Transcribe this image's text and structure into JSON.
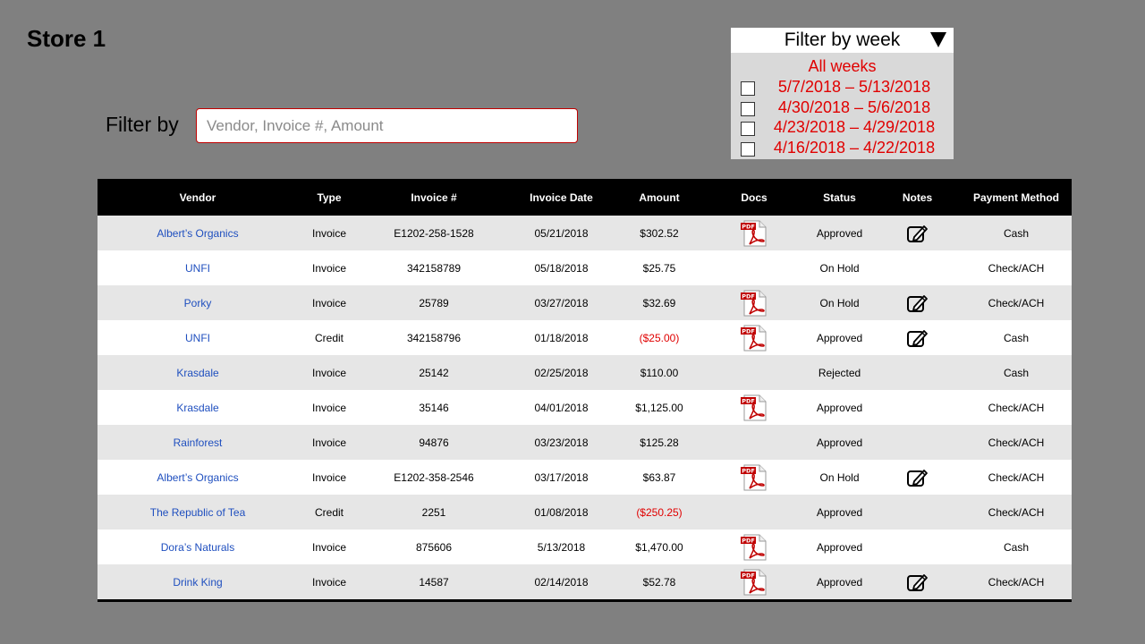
{
  "page": {
    "title": "Store 1"
  },
  "filter": {
    "label": "Filter by",
    "placeholder": "Vendor, Invoice #, Amount",
    "value": ""
  },
  "week_filter": {
    "header": "Filter by week",
    "all_label": "All weeks",
    "weeks": [
      {
        "label": "5/7/2018 – 5/13/2018",
        "checked": false
      },
      {
        "label": "4/30/2018 – 5/6/2018",
        "checked": false
      },
      {
        "label": "4/23/2018 – 4/29/2018",
        "checked": false
      },
      {
        "label": "4/16/2018 – 4/22/2018",
        "checked": false
      }
    ]
  },
  "colors": {
    "background": "#808080",
    "accent_red": "#e00000",
    "link_blue": "#1f4fbf",
    "header_bg": "#000000",
    "row_alt": "#e6e6e6"
  },
  "table": {
    "columns": [
      "Vendor",
      "Type",
      "Invoice #",
      "Invoice Date",
      "Amount",
      "Docs",
      "Status",
      "Notes",
      "Payment Method"
    ],
    "rows": [
      {
        "vendor": "Albert’s Organics",
        "type": "Invoice",
        "invoice": "E1202-258-1528",
        "date": "05/21/2018",
        "amount": "$302.52",
        "negative": false,
        "doc": "pdf-icon",
        "status": "Approved",
        "note": "edit-note-icon",
        "payment": "Cash"
      },
      {
        "vendor": "UNFI",
        "type": "Invoice",
        "invoice": "342158789",
        "date": "05/18/2018",
        "amount": "$25.75",
        "negative": false,
        "doc": "",
        "status": "On Hold",
        "note": "",
        "payment": "Check/ACH"
      },
      {
        "vendor": "Porky",
        "type": "Invoice",
        "invoice": "25789",
        "date": "03/27/2018",
        "amount": "$32.69",
        "negative": false,
        "doc": "pdf-icon",
        "status": "On Hold",
        "note": "edit-note-icon",
        "payment": "Check/ACH"
      },
      {
        "vendor": "UNFI",
        "type": "Credit",
        "invoice": "342158796",
        "date": "01/18/2018",
        "amount": "($25.00)",
        "negative": true,
        "doc": "pdf-icon",
        "status": "Approved",
        "note": "edit-note-icon",
        "payment": "Cash"
      },
      {
        "vendor": "Krasdale",
        "type": "Invoice",
        "invoice": "25142",
        "date": "02/25/2018",
        "amount": "$110.00",
        "negative": false,
        "doc": "",
        "status": "Rejected",
        "note": "",
        "payment": "Cash"
      },
      {
        "vendor": "Krasdale",
        "type": "Invoice",
        "invoice": "35146",
        "date": "04/01/2018",
        "amount": "$1,125.00",
        "negative": false,
        "doc": "pdf-icon",
        "status": "Approved",
        "note": "",
        "payment": "Check/ACH"
      },
      {
        "vendor": "Rainforest",
        "type": "Invoice",
        "invoice": "94876",
        "date": "03/23/2018",
        "amount": "$125.28",
        "negative": false,
        "doc": "",
        "status": "Approved",
        "note": "",
        "payment": "Check/ACH"
      },
      {
        "vendor": "Albert’s Organics",
        "type": "Invoice",
        "invoice": "E1202-358-2546",
        "date": "03/17/2018",
        "amount": "$63.87",
        "negative": false,
        "doc": "pdf-icon",
        "status": "On Hold",
        "note": "edit-note-icon",
        "payment": "Check/ACH"
      },
      {
        "vendor": "The Republic of Tea",
        "type": "Credit",
        "invoice": "2251",
        "date": "01/08/2018",
        "amount": "($250.25)",
        "negative": true,
        "doc": "",
        "status": "Approved",
        "note": "",
        "payment": "Check/ACH"
      },
      {
        "vendor": "Dora’s Naturals",
        "type": "Invoice",
        "invoice": "875606",
        "date": "5/13/2018",
        "amount": "$1,470.00",
        "negative": false,
        "doc": "pdf-icon",
        "status": "Approved",
        "note": "",
        "payment": "Cash"
      },
      {
        "vendor": "Drink King",
        "type": "Invoice",
        "invoice": "14587",
        "date": "02/14/2018",
        "amount": "$52.78",
        "negative": false,
        "doc": "pdf-icon",
        "status": "Approved",
        "note": "edit-note-icon",
        "payment": "Check/ACH"
      }
    ]
  }
}
